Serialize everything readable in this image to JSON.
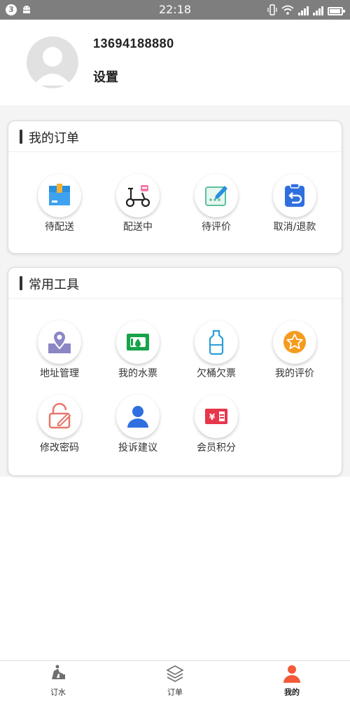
{
  "status_bar": {
    "time": "22:18",
    "notification_count": "3"
  },
  "profile": {
    "phone": "13694188880",
    "settings_label": "设置"
  },
  "orders_section": {
    "title": "我的订单",
    "items": [
      {
        "label": "待配送",
        "icon": "box-icon"
      },
      {
        "label": "配送中",
        "icon": "scooter-icon"
      },
      {
        "label": "待评价",
        "icon": "review-pen-icon"
      },
      {
        "label": "取消/退款",
        "icon": "refund-clipboard-icon"
      }
    ]
  },
  "tools_section": {
    "title": "常用工具",
    "items": [
      {
        "label": "地址管理",
        "icon": "location-pin-icon"
      },
      {
        "label": "我的水票",
        "icon": "water-ticket-icon"
      },
      {
        "label": "欠桶欠票",
        "icon": "water-bottle-icon"
      },
      {
        "label": "我的评价",
        "icon": "star-icon"
      },
      {
        "label": "修改密码",
        "icon": "lock-icon"
      },
      {
        "label": "投诉建议",
        "icon": "person-icon"
      },
      {
        "label": "会员积分",
        "icon": "coupon-icon"
      }
    ]
  },
  "bottom_nav": {
    "items": [
      {
        "label": "订水",
        "icon": "delivery-person-icon",
        "active": false
      },
      {
        "label": "订单",
        "icon": "layers-icon",
        "active": false
      },
      {
        "label": "我的",
        "icon": "user-icon",
        "active": true
      }
    ]
  },
  "colors": {
    "active_tab": "#f25a38",
    "status_bar": "#7e7e7e",
    "page_background": "#f4f4f4"
  }
}
